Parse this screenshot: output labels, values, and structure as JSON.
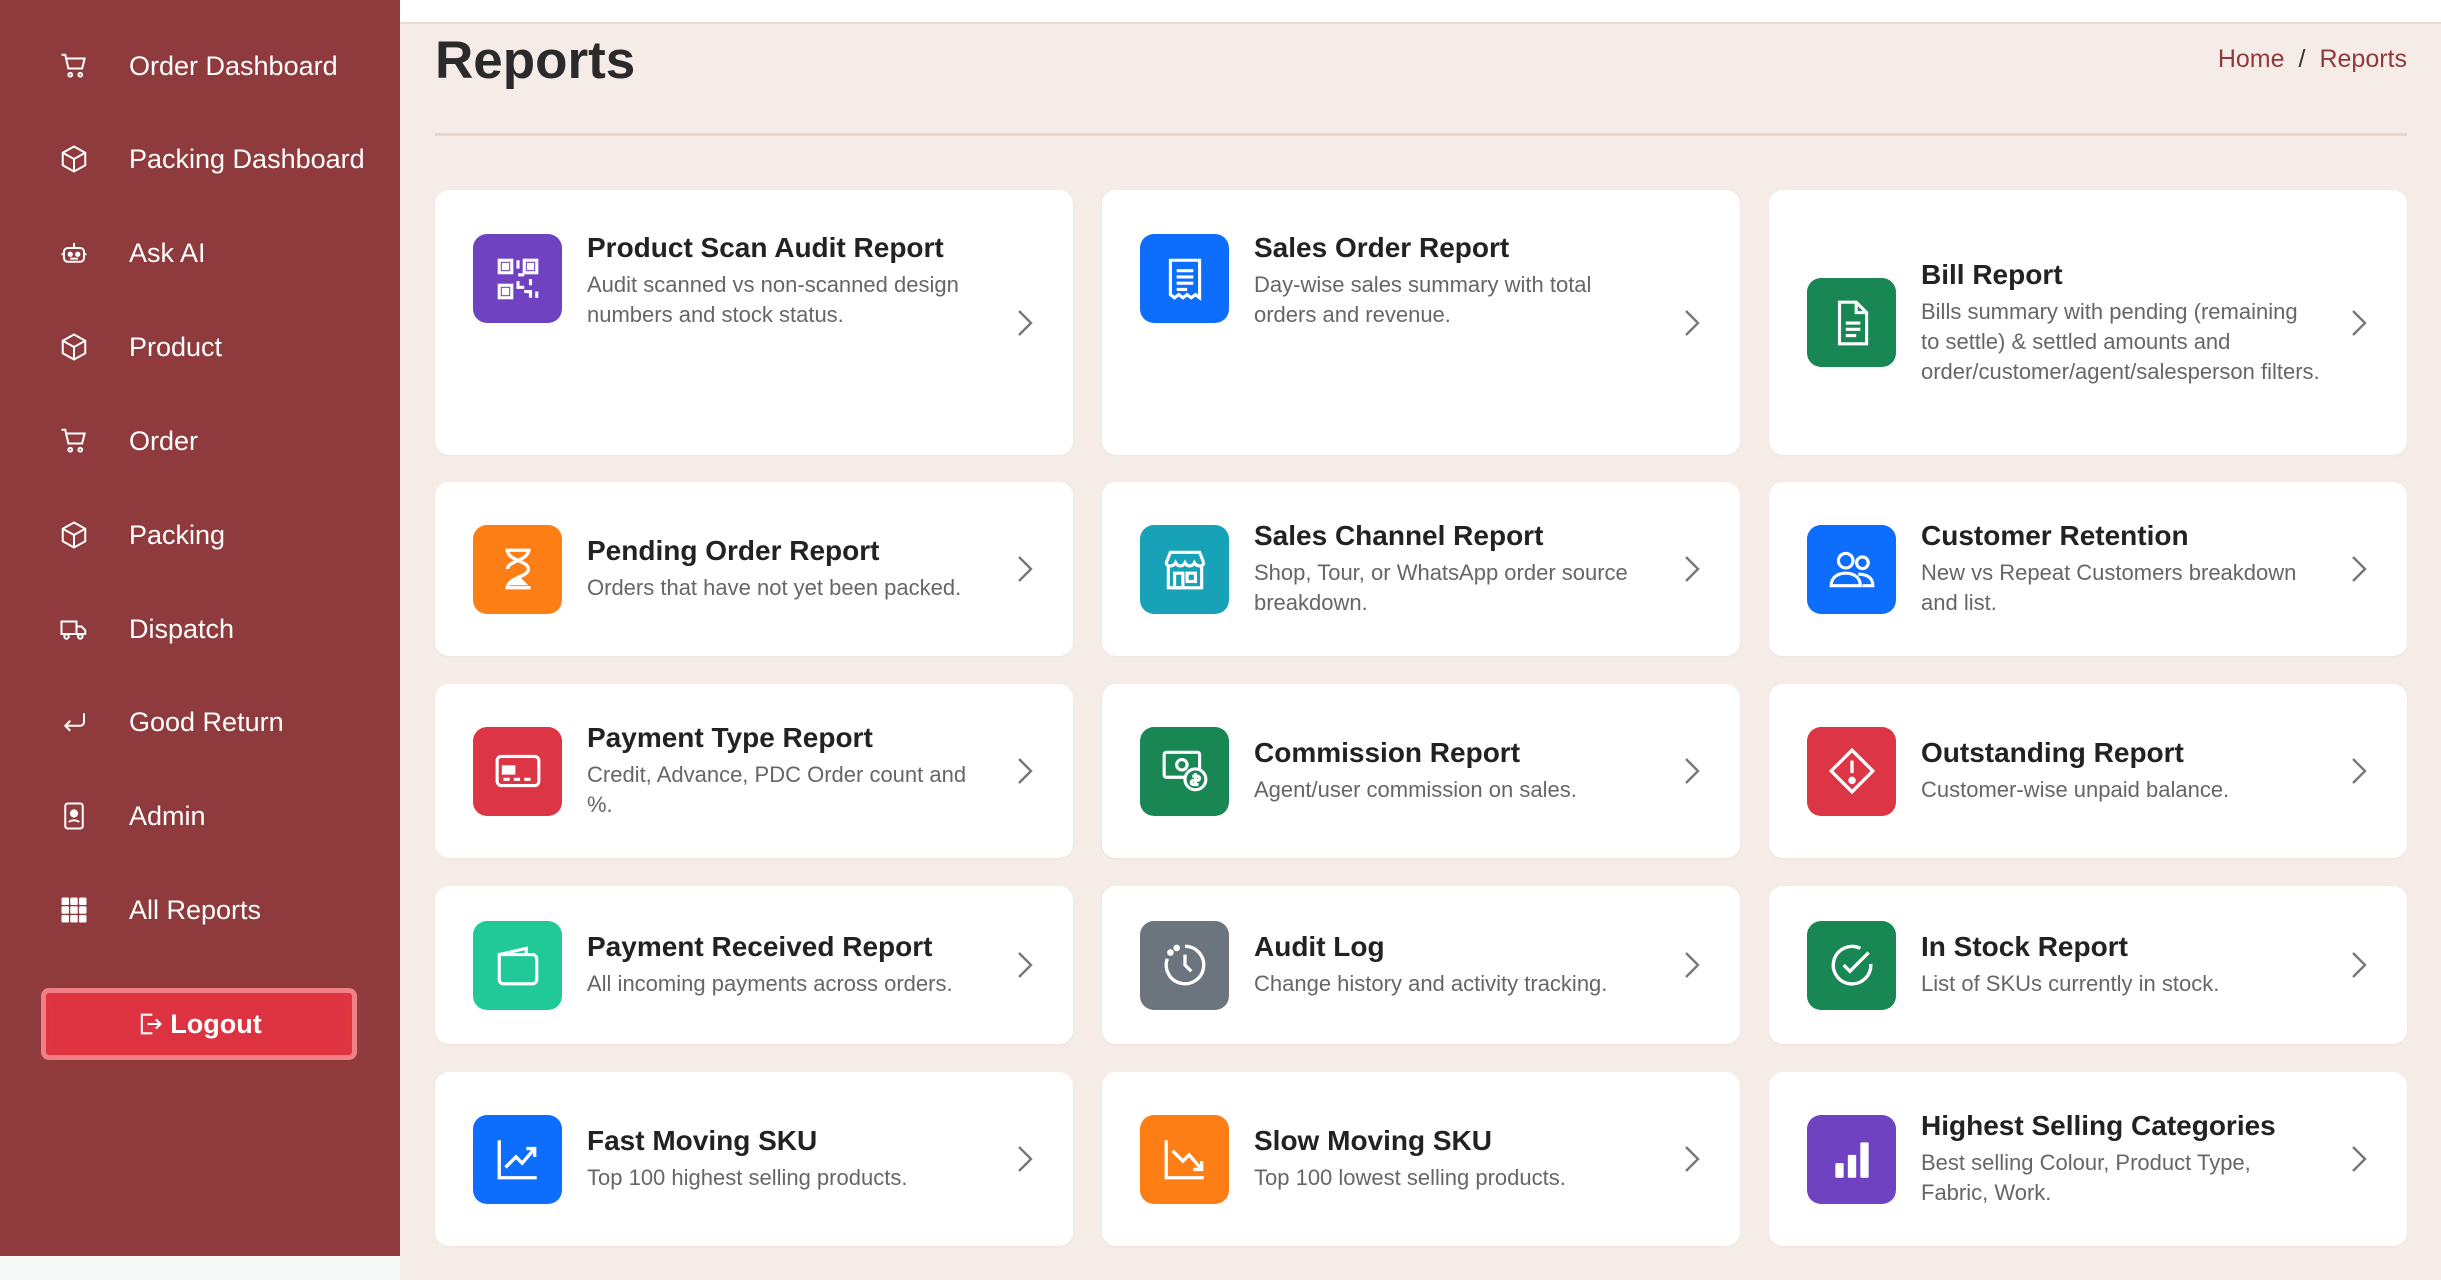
{
  "sidebar": {
    "items": [
      {
        "label": "Order Dashboard",
        "icon": "cart-icon"
      },
      {
        "label": "Packing Dashboard",
        "icon": "box-icon"
      },
      {
        "label": "Ask AI",
        "icon": "robot-icon"
      },
      {
        "label": "Product",
        "icon": "box-icon"
      },
      {
        "label": "Order",
        "icon": "cart-icon"
      },
      {
        "label": "Packing",
        "icon": "box-icon"
      },
      {
        "label": "Dispatch",
        "icon": "truck-icon"
      },
      {
        "label": "Good Return",
        "icon": "return-arrow-icon"
      },
      {
        "label": "Admin",
        "icon": "id-badge-icon"
      },
      {
        "label": "All Reports",
        "icon": "grid-icon"
      }
    ],
    "logout_label": "Logout"
  },
  "header": {
    "title": "Reports",
    "breadcrumb": {
      "home": "Home",
      "separator": "/",
      "current": "Reports"
    }
  },
  "cards": [
    {
      "title": "Product Scan Audit Report",
      "desc": "Audit scanned vs non-scanned design numbers and stock status.",
      "icon": "qr-code-icon",
      "color": "#6f42c1"
    },
    {
      "title": "Sales Order Report",
      "desc": "Day-wise sales summary with total orders and revenue.",
      "icon": "receipt-icon",
      "color": "#0d6efd"
    },
    {
      "title": "Bill Report",
      "desc": "Bills summary with pending (remaining to settle) & settled amounts and order/customer/agent/salesperson filters.",
      "icon": "document-icon",
      "color": "#198754"
    },
    {
      "title": "Pending Order Report",
      "desc": "Orders that have not yet been packed.",
      "icon": "hourglass-icon",
      "color": "#fd7e14"
    },
    {
      "title": "Sales Channel Report",
      "desc": "Shop, Tour, or WhatsApp order source breakdown.",
      "icon": "shop-icon",
      "color": "#17a2b8"
    },
    {
      "title": "Customer Retention",
      "desc": "New vs Repeat Customers breakdown and list.",
      "icon": "users-icon",
      "color": "#0d6efd"
    },
    {
      "title": "Payment Type Report",
      "desc": "Credit, Advance, PDC Order count and %.",
      "icon": "credit-card-icon",
      "color": "#dc3545"
    },
    {
      "title": "Commission Report",
      "desc": "Agent/user commission on sales.",
      "icon": "cash-coin-icon",
      "color": "#198754"
    },
    {
      "title": "Outstanding Report",
      "desc": "Customer-wise unpaid balance.",
      "icon": "warning-diamond-icon",
      "color": "#dc3545"
    },
    {
      "title": "Payment Received Report",
      "desc": "All incoming payments across orders.",
      "icon": "wallet-icon",
      "color": "#20c997"
    },
    {
      "title": "Audit Log",
      "desc": "Change history and activity tracking.",
      "icon": "clock-history-icon",
      "color": "#6c757d"
    },
    {
      "title": "In Stock Report",
      "desc": "List of SKUs currently in stock.",
      "icon": "check-circle-icon",
      "color": "#198754"
    },
    {
      "title": "Fast Moving SKU",
      "desc": "Top 100 highest selling products.",
      "icon": "trend-up-icon",
      "color": "#0d6efd"
    },
    {
      "title": "Slow Moving SKU",
      "desc": "Top 100 lowest selling products.",
      "icon": "trend-down-icon",
      "color": "#fd7e14"
    },
    {
      "title": "Highest Selling Categories",
      "desc": "Best selling Colour, Product Type, Fabric, Work.",
      "icon": "bar-chart-icon",
      "color": "#6f42c1"
    }
  ]
}
